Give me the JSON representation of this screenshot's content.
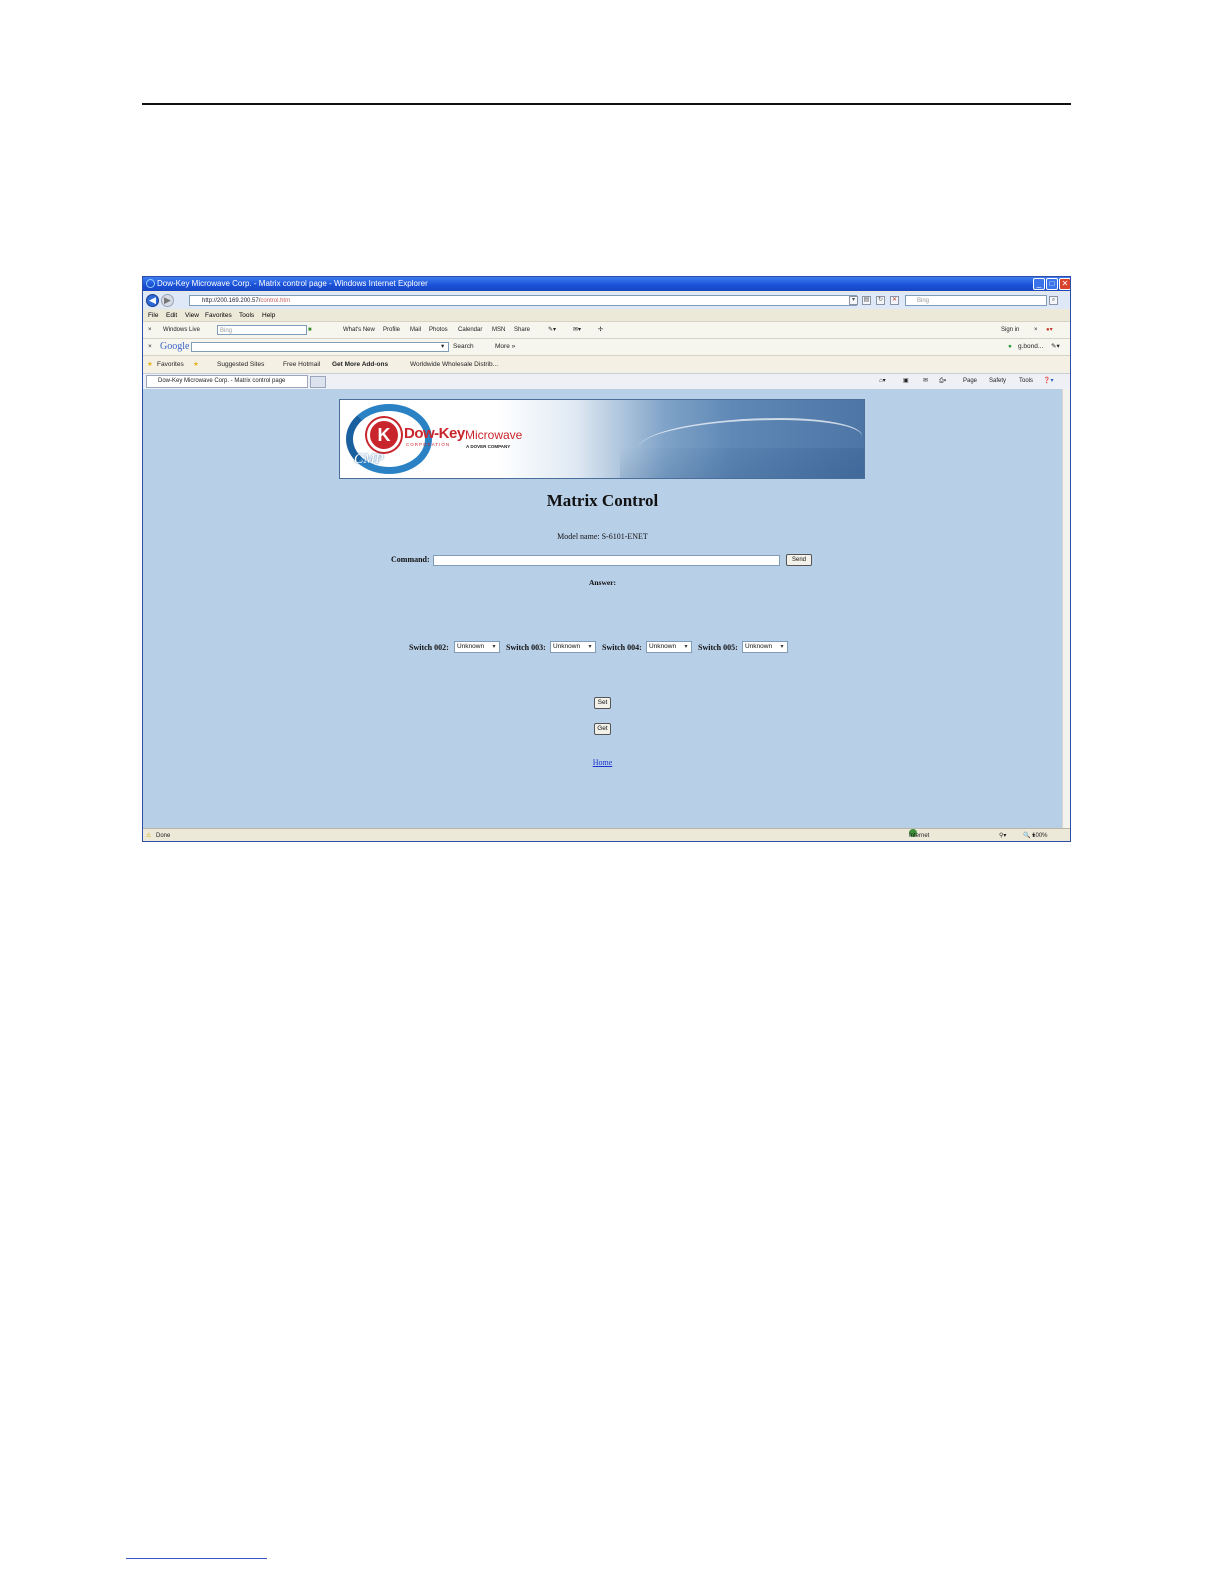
{
  "window": {
    "title": "Dow-Key Microwave Corp. - Matrix control page - Windows Internet Explorer",
    "minimize": "_",
    "maximize": "□",
    "close": "✕"
  },
  "address": {
    "url_host": "http://200.169.200.57/",
    "url_path": "control.htm",
    "search_placeholder": "Bing"
  },
  "menu": [
    "File",
    "Edit",
    "View",
    "Favorites",
    "Tools",
    "Help"
  ],
  "live_toolbar": {
    "brand": "Windows Live",
    "search_placeholder": "Bing",
    "links": [
      "What's New",
      "Profile",
      "Mail",
      "Photos",
      "Calendar",
      "MSN",
      "Share"
    ],
    "sign_in": "Sign in"
  },
  "google_toolbar": {
    "logo": "Google",
    "search": "Search",
    "more": "More »",
    "user": "g.bond..."
  },
  "favorites_bar": {
    "favorites": "Favorites",
    "items": [
      "Suggested Sites",
      "Free Hotmail",
      "Get More Add-ons",
      "Worldwide Wholesale Distrib..."
    ]
  },
  "tab": {
    "label": "Dow-Key Microwave Corp. - Matrix control page"
  },
  "command_bar": [
    "Page",
    "Safety",
    "Tools"
  ],
  "banner": {
    "brand": "Dow-Key",
    "brand2": "Microwave",
    "corp": "CORPORATION",
    "sub": "A DOVER COMPANY",
    "cmp": "CMP"
  },
  "page": {
    "title": "Matrix Control",
    "model": "Model name: S-6101-ENET",
    "command_label": "Command:",
    "send": "Send",
    "answer": "Answer:",
    "switches": [
      {
        "label": "Switch 002:",
        "value": "Unknown"
      },
      {
        "label": "Switch 003:",
        "value": "Unknown"
      },
      {
        "label": "Switch 004:",
        "value": "Unknown"
      },
      {
        "label": "Switch 005:",
        "value": "Unknown"
      }
    ],
    "set": "Set",
    "get": "Get",
    "home": "Home"
  },
  "status": {
    "text": "Done",
    "zone": "Internet",
    "zoom": "100%"
  }
}
